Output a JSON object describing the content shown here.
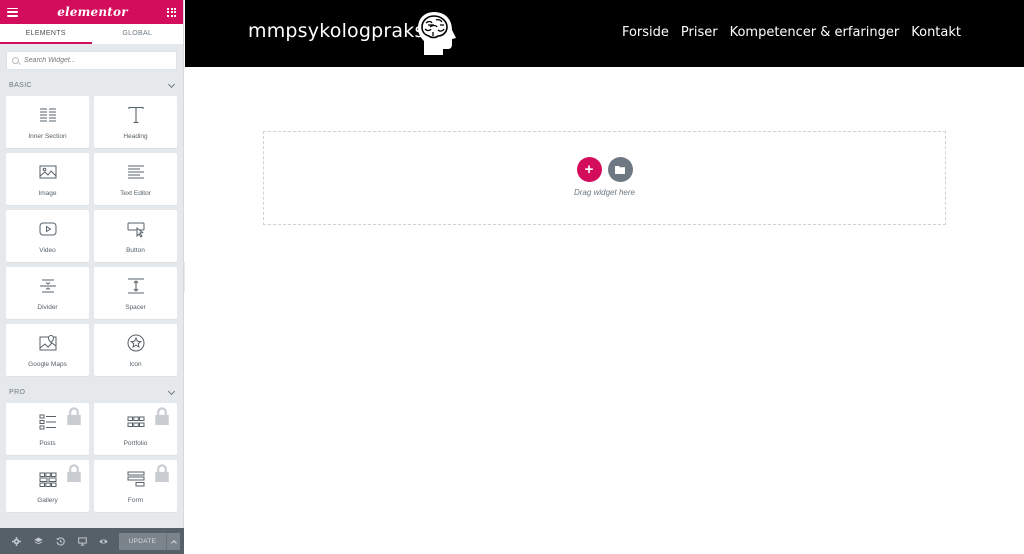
{
  "editor": {
    "logo": "elementor",
    "tabs": [
      {
        "label": "ELEMENTS"
      },
      {
        "label": "GLOBAL"
      }
    ],
    "search_placeholder": "Search Widget...",
    "categories": {
      "basic": {
        "title": "BASIC",
        "widgets": [
          {
            "label": "Inner Section",
            "icon": "columns-icon"
          },
          {
            "label": "Heading",
            "icon": "heading-icon"
          },
          {
            "label": "Image",
            "icon": "image-icon"
          },
          {
            "label": "Text Editor",
            "icon": "text-editor-icon"
          },
          {
            "label": "Video",
            "icon": "video-icon"
          },
          {
            "label": "Button",
            "icon": "button-icon"
          },
          {
            "label": "Divider",
            "icon": "divider-icon"
          },
          {
            "label": "Spacer",
            "icon": "spacer-icon"
          },
          {
            "label": "Google Maps",
            "icon": "map-icon"
          },
          {
            "label": "Icon",
            "icon": "star-icon"
          }
        ]
      },
      "pro": {
        "title": "PRO",
        "widgets": [
          {
            "label": "Posts",
            "icon": "posts-icon",
            "locked": true
          },
          {
            "label": "Portfolio",
            "icon": "portfolio-icon",
            "locked": true
          },
          {
            "label": "Gallery",
            "icon": "gallery-icon",
            "locked": true
          },
          {
            "label": "Form",
            "icon": "form-icon",
            "locked": true
          }
        ]
      }
    },
    "footer": {
      "icons": [
        "settings-icon",
        "layers-icon",
        "history-icon",
        "responsive-icon",
        "preview-icon"
      ],
      "update_label": "UPDATE"
    },
    "colors": {
      "accent": "#d30c5c",
      "panel_bg": "#e6e9ec",
      "footer_bg": "#556068"
    }
  },
  "site": {
    "title": "mmpsykologpraksis",
    "nav": [
      {
        "label": "Forside"
      },
      {
        "label": "Priser"
      },
      {
        "label": "Kompetencer & erfaringer"
      },
      {
        "label": "Kontakt"
      }
    ],
    "dropzone_text": "Drag widget here"
  }
}
